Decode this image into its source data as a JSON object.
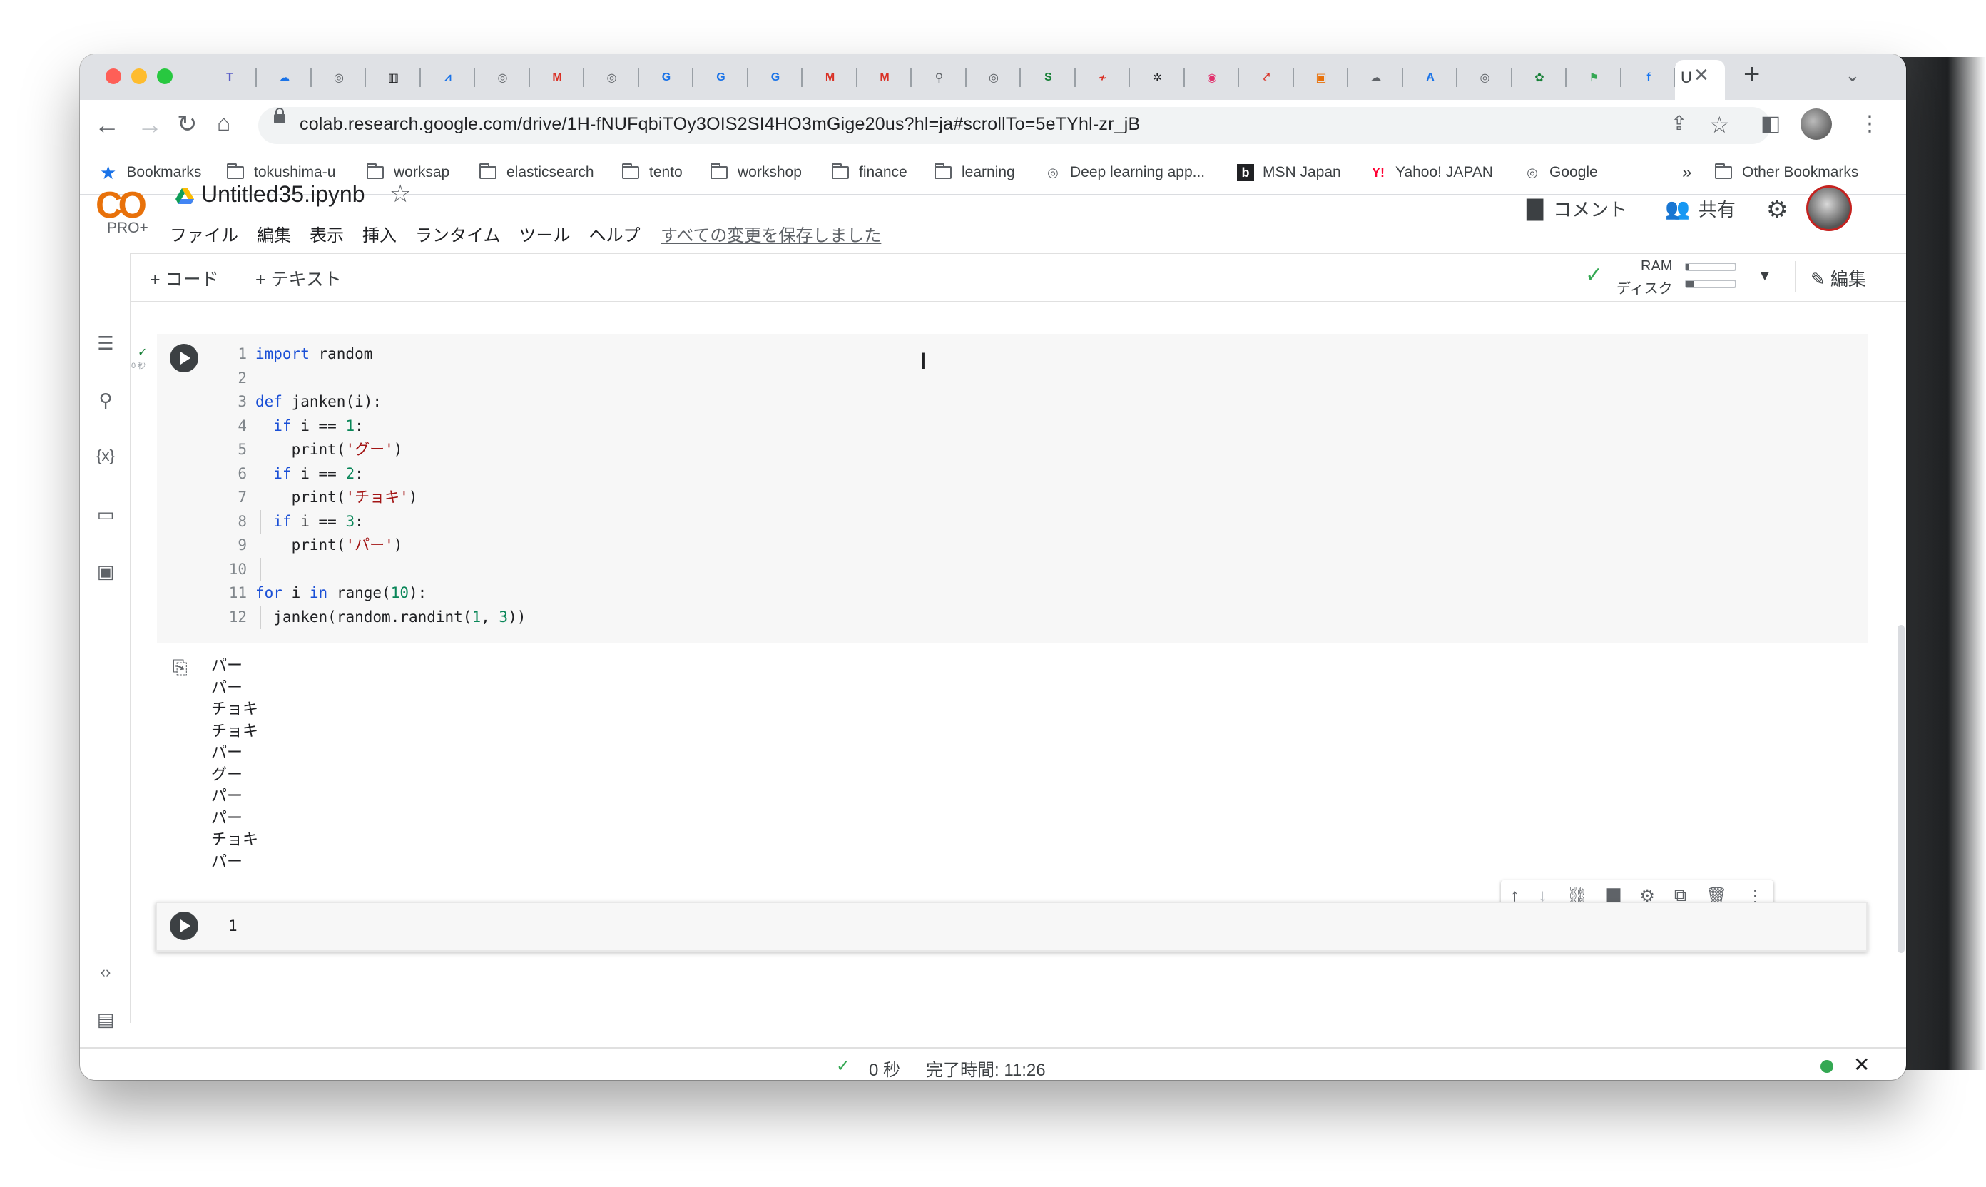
{
  "browser": {
    "tabs": [
      {
        "icon": "teams-icon",
        "letter": "T",
        "color": "#5b5fc7"
      },
      {
        "icon": "cloud-icon",
        "letter": "☁",
        "color": "#1a73e8"
      },
      {
        "icon": "globe-icon",
        "letter": "◎",
        "color": "#5f6368"
      },
      {
        "icon": "doc-icon",
        "letter": "▥",
        "color": "#202124"
      },
      {
        "icon": "chart-icon",
        "letter": "⩘",
        "color": "#1a73e8"
      },
      {
        "icon": "globe-icon",
        "letter": "◎",
        "color": "#5f6368"
      },
      {
        "icon": "gmail-icon",
        "letter": "M",
        "color": "#d93025"
      },
      {
        "icon": "globe-icon",
        "letter": "◎",
        "color": "#5f6368"
      },
      {
        "icon": "google-icon",
        "letter": "G",
        "color": "#1a73e8"
      },
      {
        "icon": "google-icon",
        "letter": "G",
        "color": "#1a73e8"
      },
      {
        "icon": "google-icon",
        "letter": "G",
        "color": "#1a73e8"
      },
      {
        "icon": "gmail-icon",
        "letter": "M",
        "color": "#d93025"
      },
      {
        "icon": "gmail-icon",
        "letter": "M",
        "color": "#d93025"
      },
      {
        "icon": "pin-icon",
        "letter": "⚲",
        "color": "#5f6368"
      },
      {
        "icon": "globe-icon",
        "letter": "◎",
        "color": "#5f6368"
      },
      {
        "icon": "sd-icon",
        "letter": "S",
        "color": "#188038"
      },
      {
        "icon": "mark-icon",
        "letter": "≁",
        "color": "#d93025"
      },
      {
        "icon": "openai-icon",
        "letter": "✲",
        "color": "#202124"
      },
      {
        "icon": "instagram-icon",
        "letter": "◉",
        "color": "#e1306c"
      },
      {
        "icon": "link-icon",
        "letter": "⤤",
        "color": "#d93025"
      },
      {
        "icon": "image-icon",
        "letter": "▣",
        "color": "#e8710a"
      },
      {
        "icon": "cloud-icon",
        "letter": "☁",
        "color": "#5f6368"
      },
      {
        "icon": "translate-icon",
        "letter": "A",
        "color": "#1a73e8"
      },
      {
        "icon": "globe-icon",
        "letter": "◎",
        "color": "#5f6368"
      },
      {
        "icon": "leaf-icon",
        "letter": "✿",
        "color": "#188038"
      },
      {
        "icon": "maps-icon",
        "letter": "⚑",
        "color": "#34a853"
      },
      {
        "icon": "facebook-icon",
        "letter": "f",
        "color": "#1877f2"
      }
    ],
    "active_tab_letter": "U",
    "url": "colab.research.google.com/drive/1H-fNUFqbiTOy3OIS2SI4HO3mGige20us?hl=ja#scrollTo=5eTYhl-zr_jB",
    "bookmarks": [
      {
        "label": "Bookmarks",
        "type": "star"
      },
      {
        "label": "tokushima-u",
        "type": "folder"
      },
      {
        "label": "worksap",
        "type": "folder"
      },
      {
        "label": "elasticsearch",
        "type": "folder"
      },
      {
        "label": "tento",
        "type": "folder"
      },
      {
        "label": "workshop",
        "type": "folder"
      },
      {
        "label": "finance",
        "type": "folder"
      },
      {
        "label": "learning",
        "type": "folder"
      },
      {
        "label": "Deep learning app...",
        "type": "site"
      },
      {
        "label": "MSN Japan",
        "type": "site"
      },
      {
        "label": "Yahoo! JAPAN",
        "type": "site"
      },
      {
        "label": "Google",
        "type": "site"
      }
    ],
    "bookmarks_overflow": "»",
    "other_bookmarks": "Other Bookmarks"
  },
  "colab": {
    "logo": "CO",
    "plan": "PRO+",
    "notebook_title": "Untitled35.ipynb",
    "menu": [
      "ファイル",
      "編集",
      "表示",
      "挿入",
      "ランタイム",
      "ツール",
      "ヘルプ"
    ],
    "save_status": "すべての変更を保存しました",
    "comment_label": "コメント",
    "share_label": "共有",
    "add_code": "+ コード",
    "add_text": "+ テキスト",
    "ram_label": "RAM",
    "disk_label": "ディスク",
    "ram_usage": 0.05,
    "disk_usage": 0.15,
    "edit_label": "編集"
  },
  "cell1": {
    "lines": [
      {
        "n": "1",
        "indent": 0,
        "tokens": [
          {
            "t": "import",
            "c": "kw"
          },
          {
            "t": " random",
            "c": "ink"
          }
        ]
      },
      {
        "n": "2",
        "indent": 0,
        "tokens": []
      },
      {
        "n": "3",
        "indent": 0,
        "tokens": [
          {
            "t": "def",
            "c": "kw"
          },
          {
            "t": " janken",
            "c": "ink"
          },
          {
            "t": "(i):",
            "c": "ink"
          }
        ]
      },
      {
        "n": "4",
        "indent": 1,
        "tokens": [
          {
            "t": "if",
            "c": "kw"
          },
          {
            "t": " i ",
            "c": "ink"
          },
          {
            "t": "==",
            "c": "ink"
          },
          {
            "t": " 1",
            "c": "num"
          },
          {
            "t": ":",
            "c": "ink"
          }
        ]
      },
      {
        "n": "5",
        "indent": 2,
        "tokens": [
          {
            "t": "print",
            "c": "ink"
          },
          {
            "t": "(",
            "c": "ink"
          },
          {
            "t": "'グー'",
            "c": "str"
          },
          {
            "t": ")",
            "c": "ink"
          }
        ]
      },
      {
        "n": "6",
        "indent": 1,
        "tokens": [
          {
            "t": "if",
            "c": "kw"
          },
          {
            "t": " i ",
            "c": "ink"
          },
          {
            "t": "==",
            "c": "ink"
          },
          {
            "t": " 2",
            "c": "num"
          },
          {
            "t": ":",
            "c": "ink"
          }
        ]
      },
      {
        "n": "7",
        "indent": 2,
        "tokens": [
          {
            "t": "print",
            "c": "ink"
          },
          {
            "t": "(",
            "c": "ink"
          },
          {
            "t": "'チョキ'",
            "c": "str"
          },
          {
            "t": ")",
            "c": "ink"
          }
        ]
      },
      {
        "n": "8",
        "indent": 1,
        "tokens": [
          {
            "t": "if",
            "c": "kw"
          },
          {
            "t": " i ",
            "c": "ink"
          },
          {
            "t": "==",
            "c": "ink"
          },
          {
            "t": " 3",
            "c": "num"
          },
          {
            "t": ":",
            "c": "ink"
          }
        ]
      },
      {
        "n": "9",
        "indent": 2,
        "tokens": [
          {
            "t": "print",
            "c": "ink"
          },
          {
            "t": "(",
            "c": "ink"
          },
          {
            "t": "'パー'",
            "c": "str"
          },
          {
            "t": ")",
            "c": "ink"
          }
        ]
      },
      {
        "n": "10",
        "indent": 0,
        "tokens": []
      },
      {
        "n": "11",
        "indent": 0,
        "tokens": [
          {
            "t": "for",
            "c": "kw"
          },
          {
            "t": " i ",
            "c": "ink"
          },
          {
            "t": "in",
            "c": "kw"
          },
          {
            "t": " range",
            "c": "ink"
          },
          {
            "t": "(",
            "c": "ink"
          },
          {
            "t": "10",
            "c": "num"
          },
          {
            "t": "):",
            "c": "ink"
          }
        ]
      },
      {
        "n": "12",
        "indent": 1,
        "tokens": [
          {
            "t": "janken(random.randint(",
            "c": "ink"
          },
          {
            "t": "1",
            "c": "num"
          },
          {
            "t": ", ",
            "c": "ink"
          },
          {
            "t": "3",
            "c": "num"
          },
          {
            "t": "))",
            "c": "ink"
          }
        ]
      }
    ],
    "output": [
      "パー",
      "パー",
      "チョキ",
      "チョキ",
      "パー",
      "グー",
      "パー",
      "パー",
      "チョキ",
      "パー"
    ]
  },
  "cell2": {
    "line_number": "1"
  },
  "status": {
    "check": "✓",
    "duration": "0 秒",
    "completed": "完了時間: 11:26"
  }
}
